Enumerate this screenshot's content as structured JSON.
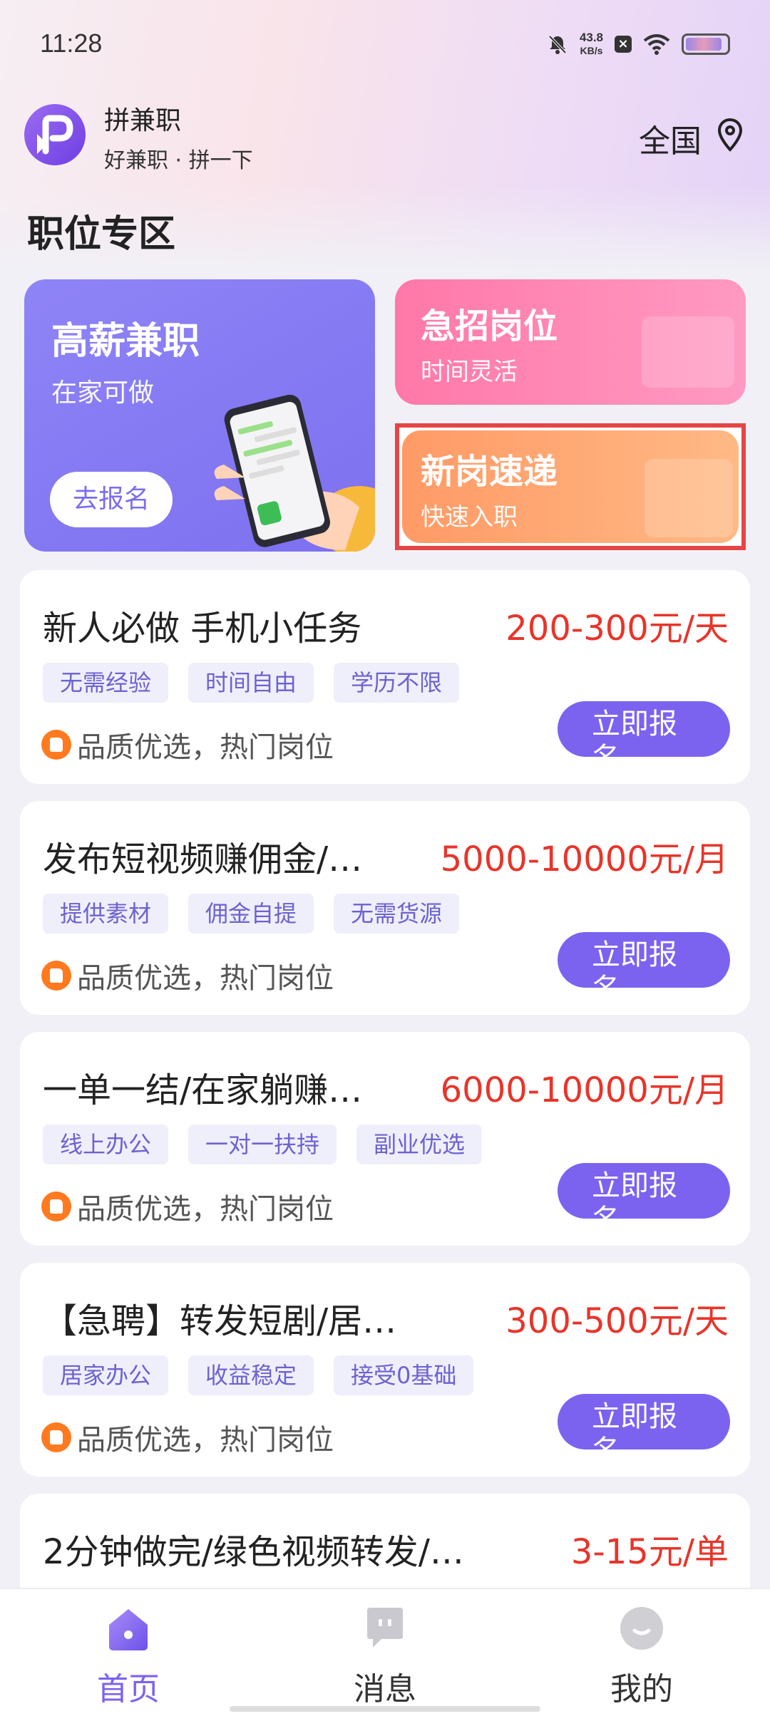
{
  "status_bar": {
    "time": "11:28",
    "net_speed_value": "43.8",
    "net_speed_unit": "KB/s",
    "battery_level_percent": 90
  },
  "header": {
    "app_name": "拼兼职",
    "slogan": "好兼职 · 拼一下",
    "region": "全国"
  },
  "section_title": "职位专区",
  "promos": {
    "big": {
      "title": "高薪兼职",
      "subtitle": "在家可做",
      "button": "去报名"
    },
    "urgent": {
      "title": "急招岗位",
      "subtitle": "时间灵活"
    },
    "new": {
      "title": "新岗速递",
      "subtitle": "快速入职"
    }
  },
  "jobs": [
    {
      "title": "新人必做 手机小任务",
      "salary": "200-300元/天",
      "tags": [
        "无需经验",
        "时间自由",
        "学历不限"
      ],
      "quality": "品质优选，热门岗位",
      "apply": "立即报名"
    },
    {
      "title": "发布短视频赚佣金/…",
      "salary": "5000-10000元/月",
      "tags": [
        "提供素材",
        "佣金自提",
        "无需货源"
      ],
      "quality": "品质优选，热门岗位",
      "apply": "立即报名"
    },
    {
      "title": "一单一结/在家躺赚…",
      "salary": "6000-10000元/月",
      "tags": [
        "线上办公",
        "一对一扶持",
        "副业优选"
      ],
      "quality": "品质优选，热门岗位",
      "apply": "立即报名"
    },
    {
      "title": "【急聘】转发短剧/居…",
      "salary": "300-500元/天",
      "tags": [
        "居家办公",
        "收益稳定",
        "接受0基础"
      ],
      "quality": "品质优选，热门岗位",
      "apply": "立即报名"
    },
    {
      "title": "2分钟做完/绿色视频转发/…",
      "salary": "3-15元/单"
    }
  ],
  "nav": {
    "items": [
      {
        "label": "首页",
        "icon": "home-icon",
        "active": true
      },
      {
        "label": "消息",
        "icon": "message-icon",
        "active": false
      },
      {
        "label": "我的",
        "icon": "profile-icon",
        "active": false
      }
    ],
    "colors": {
      "active": "#7b63f0",
      "inactive": "#333333"
    }
  },
  "colors": {
    "brand_purple": "#7b63f0",
    "salary_red": "#e8352a",
    "urgent_pink": "#ff78a8",
    "new_orange": "#ff9a66",
    "highlight_border": "#e64545"
  }
}
